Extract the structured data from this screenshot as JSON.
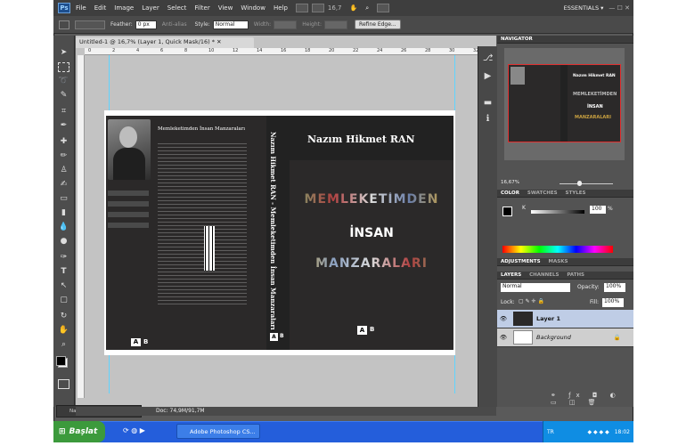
{
  "menubar": {
    "logo": "Ps",
    "items": [
      "File",
      "Edit",
      "Image",
      "Layer",
      "Select",
      "Filter",
      "View",
      "Window",
      "Help"
    ],
    "zoom": "16,7",
    "workspace": "ESSENTIALS ▾",
    "window_controls": "— ☐ ✕"
  },
  "options": {
    "feather_label": "Feather:",
    "feather_value": "0 px",
    "antialias_label": "Anti-alias",
    "style_label": "Style:",
    "style_value": "Normal",
    "width_label": "Width:",
    "height_label": "Height:",
    "refine_edge": "Refine Edge..."
  },
  "document": {
    "tab_title": "Untitled-1 @ 16,7% (Layer 1, Quick Mask/16) * ✕",
    "zoom_status": "16,67%",
    "doc_status": "Doc: 74,9M/91,7M",
    "ruler_marks": [
      "0",
      "2",
      "4",
      "6",
      "8",
      "10",
      "12",
      "14",
      "16",
      "18",
      "20",
      "22",
      "24",
      "26",
      "28",
      "30",
      "32"
    ]
  },
  "cover": {
    "back_title": "Memleketimden İnsan Manzaraları",
    "spine_text": "Nazım Hikmet RAN - Memleketimden İnsan Manzaraları",
    "author": "Nazım Hikmet RAN",
    "title_line1": "MEMLEKETİMDEN",
    "title_line2": "İNSAN",
    "title_line3": "MANZARALARI",
    "publisher_mark": "A",
    "publisher_letter": "B"
  },
  "navigator": {
    "tab": "NAVIGATOR",
    "zoom": "16,67%"
  },
  "color_panel": {
    "tabs": [
      "COLOR",
      "SWATCHES",
      "STYLES"
    ],
    "k_label": "K",
    "k_value": "100",
    "percent": "%"
  },
  "adjustments": {
    "tabs": [
      "ADJUSTMENTS",
      "MASKS"
    ]
  },
  "layers_panel": {
    "tabs": [
      "LAYERS",
      "CHANNELS",
      "PATHS"
    ],
    "blend_mode": "Normal",
    "opacity_label": "Opacity:",
    "opacity_value": "100%",
    "lock_label": "Lock:",
    "fill_label": "Fill:",
    "fill_value": "100%",
    "layers": [
      "Layer 1",
      "Background"
    ]
  },
  "minimized": {
    "label": "Nazım Hi...",
    "controls": "— ☐ ✕"
  },
  "taskbar": {
    "start": "Başlat",
    "task": "Adobe Photoshop CS...",
    "lang": "TR",
    "clock": "18:02"
  },
  "colors": {
    "accent": "#245edb",
    "canvas_bg": "#c3c3c3",
    "cover_bg": "#2b2929"
  }
}
